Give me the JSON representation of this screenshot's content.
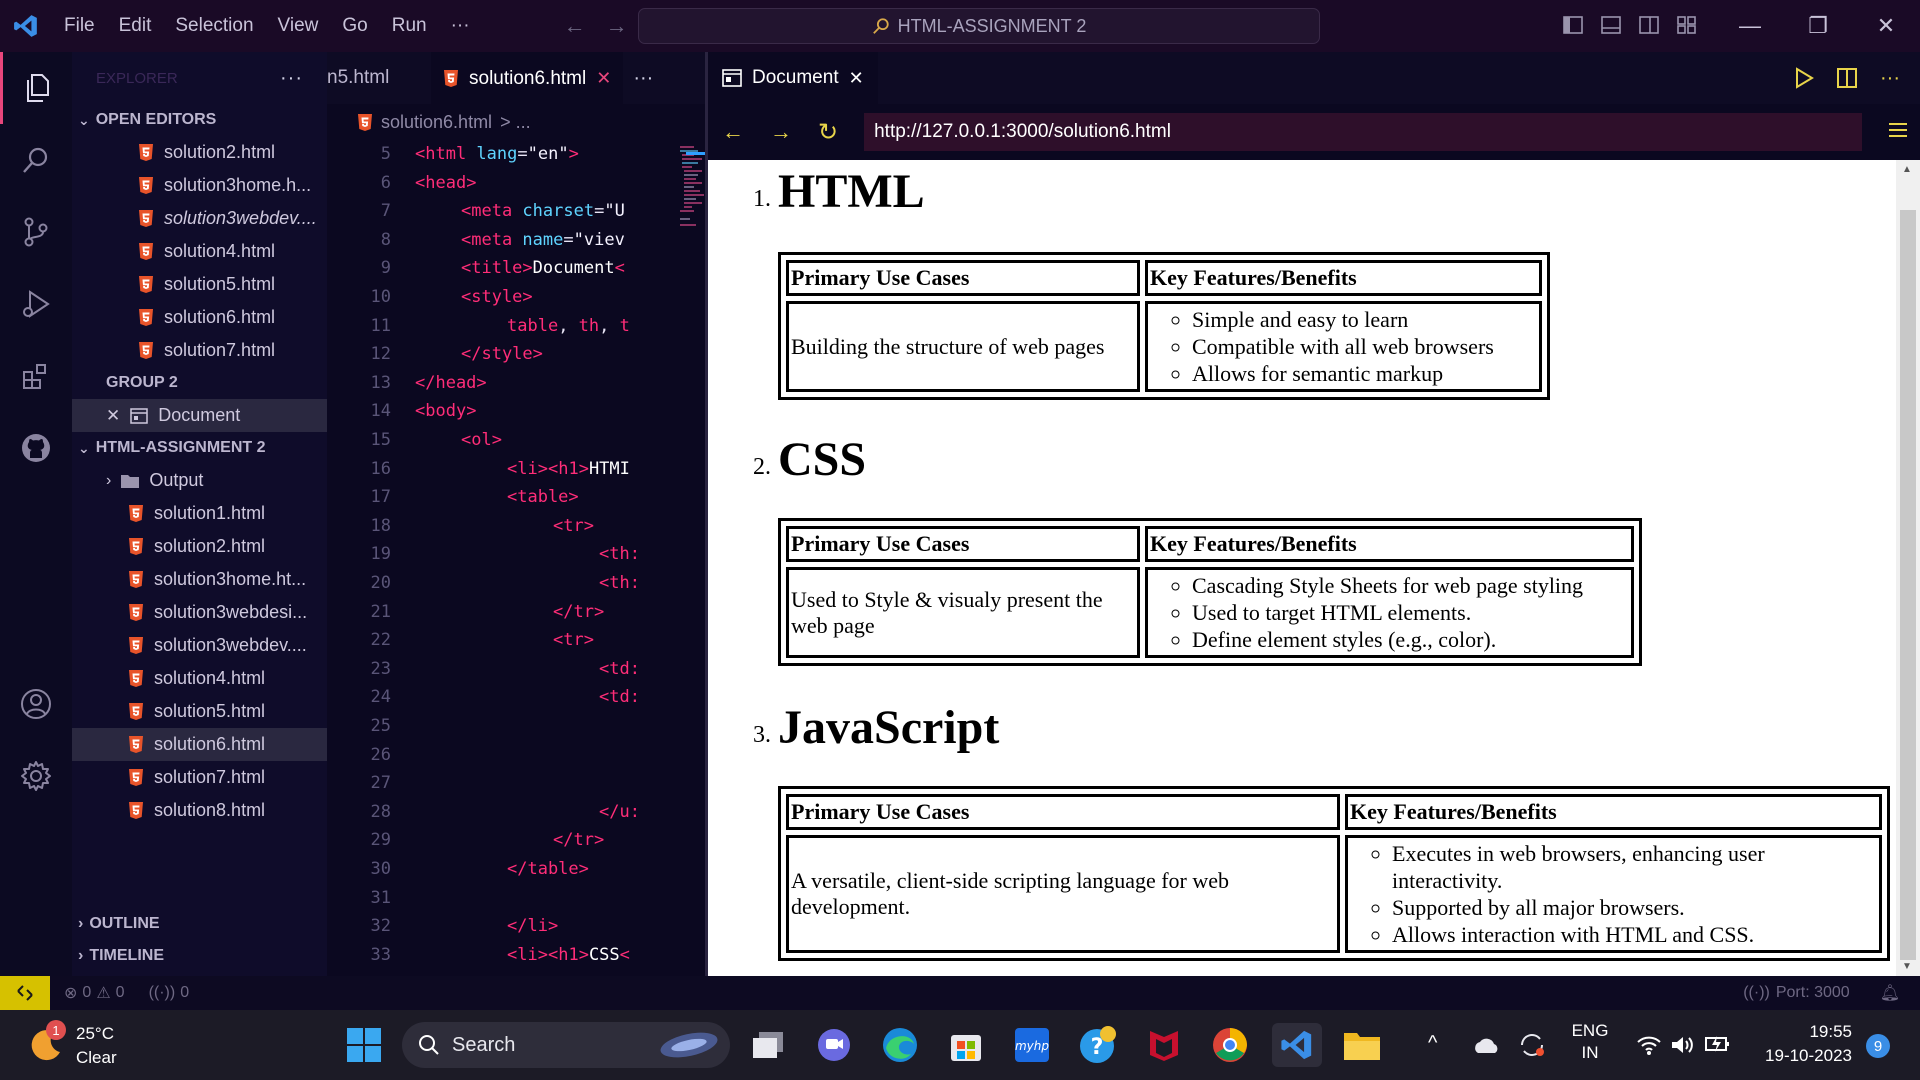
{
  "titlebar": {
    "menu": [
      "File",
      "Edit",
      "Selection",
      "View",
      "Go",
      "Run",
      "···"
    ],
    "search_text": "HTML-ASSIGNMENT 2"
  },
  "sidebar": {
    "header": "EXPLORER",
    "open_editors_title": "OPEN EDITORS",
    "open_editors": [
      {
        "label": "solution2.html",
        "italic": false
      },
      {
        "label": "solution3home.h...",
        "italic": false
      },
      {
        "label": "solution3webdev....",
        "italic": true
      },
      {
        "label": "solution4.html",
        "italic": false
      },
      {
        "label": "solution5.html",
        "italic": false
      },
      {
        "label": "solution6.html",
        "italic": false
      },
      {
        "label": "solution7.html",
        "italic": false
      }
    ],
    "group2_title": "GROUP 2",
    "group2_item": "Document",
    "project_title": "HTML-ASSIGNMENT 2",
    "folder": "Output",
    "files": [
      "solution1.html",
      "solution2.html",
      "solution3home.ht...",
      "solution3webdesi...",
      "solution3webdev....",
      "solution4.html",
      "solution5.html",
      "solution6.html",
      "solution7.html",
      "solution8.html"
    ],
    "selected_file": "solution6.html",
    "outline_title": "OUTLINE",
    "timeline_title": "TIMELINE"
  },
  "editor": {
    "tab_partial": "n5.html",
    "tab_active": "solution6.html",
    "breadcrumb_file": "solution6.html",
    "breadcrumb_rest": "> ...",
    "lines": [
      {
        "n": "5",
        "indent": 0,
        "parts": [
          [
            "tg",
            "<html"
          ],
          [
            "at",
            " lang"
          ],
          [
            "pn",
            "="
          ],
          [
            "st",
            "\"en\""
          ],
          [
            "tg",
            ">"
          ]
        ]
      },
      {
        "n": "6",
        "indent": 0,
        "parts": [
          [
            "tg",
            "<head"
          ],
          [
            "tg",
            ">"
          ]
        ]
      },
      {
        "n": "7",
        "indent": 1,
        "parts": [
          [
            "tg",
            "<meta"
          ],
          [
            "at",
            " charset"
          ],
          [
            "pn",
            "="
          ],
          [
            "st",
            "\"U"
          ]
        ]
      },
      {
        "n": "8",
        "indent": 1,
        "parts": [
          [
            "tg",
            "<meta"
          ],
          [
            "at",
            " name"
          ],
          [
            "pn",
            "="
          ],
          [
            "st",
            "\"viev"
          ]
        ]
      },
      {
        "n": "9",
        "indent": 1,
        "parts": [
          [
            "tg",
            "<title"
          ],
          [
            "tg",
            ">"
          ],
          [
            "tx",
            "Document"
          ],
          [
            "tg",
            "<"
          ]
        ]
      },
      {
        "n": "10",
        "indent": 1,
        "parts": [
          [
            "tg",
            "<style"
          ],
          [
            "tg",
            ">"
          ]
        ]
      },
      {
        "n": "11",
        "indent": 2,
        "parts": [
          [
            "tg",
            "table"
          ],
          [
            "pn",
            ", "
          ],
          [
            "tg",
            "th"
          ],
          [
            "pn",
            ", "
          ],
          [
            "tg",
            "t"
          ]
        ]
      },
      {
        "n": "12",
        "indent": 1,
        "parts": [
          [
            "tg",
            "</style"
          ],
          [
            "tg",
            ">"
          ]
        ]
      },
      {
        "n": "13",
        "indent": 0,
        "parts": [
          [
            "tg",
            "</head"
          ],
          [
            "tg",
            ">"
          ]
        ]
      },
      {
        "n": "14",
        "indent": 0,
        "parts": [
          [
            "tg",
            "<body"
          ],
          [
            "tg",
            ">"
          ]
        ]
      },
      {
        "n": "15",
        "indent": 1,
        "parts": [
          [
            "tg",
            "<ol"
          ],
          [
            "tg",
            ">"
          ]
        ]
      },
      {
        "n": "16",
        "indent": 2,
        "parts": [
          [
            "tg",
            "<li"
          ],
          [
            "tg",
            ">"
          ],
          [
            "tg",
            "<h1"
          ],
          [
            "tg",
            ">"
          ],
          [
            "tx",
            "HTMI"
          ]
        ]
      },
      {
        "n": "17",
        "indent": 2,
        "parts": [
          [
            "tg",
            "<table"
          ],
          [
            "tg",
            ">"
          ]
        ]
      },
      {
        "n": "18",
        "indent": 3,
        "parts": [
          [
            "tg",
            "<tr"
          ],
          [
            "tg",
            ">"
          ]
        ]
      },
      {
        "n": "19",
        "indent": 4,
        "parts": [
          [
            "tg",
            "<th:"
          ]
        ]
      },
      {
        "n": "20",
        "indent": 4,
        "parts": [
          [
            "tg",
            "<th:"
          ]
        ]
      },
      {
        "n": "21",
        "indent": 3,
        "parts": [
          [
            "tg",
            "</tr"
          ],
          [
            "tg",
            ">"
          ]
        ]
      },
      {
        "n": "22",
        "indent": 3,
        "parts": [
          [
            "tg",
            "<tr"
          ],
          [
            "tg",
            ">"
          ]
        ]
      },
      {
        "n": "23",
        "indent": 4,
        "parts": [
          [
            "tg",
            "<td:"
          ]
        ]
      },
      {
        "n": "24",
        "indent": 4,
        "parts": [
          [
            "tg",
            "<td:"
          ]
        ]
      },
      {
        "n": "25",
        "indent": 0,
        "parts": []
      },
      {
        "n": "26",
        "indent": 0,
        "parts": []
      },
      {
        "n": "27",
        "indent": 0,
        "parts": []
      },
      {
        "n": "28",
        "indent": 4,
        "parts": [
          [
            "tg",
            "</u:"
          ]
        ]
      },
      {
        "n": "29",
        "indent": 3,
        "parts": [
          [
            "tg",
            "</tr"
          ],
          [
            "tg",
            ">"
          ]
        ]
      },
      {
        "n": "30",
        "indent": 2,
        "parts": [
          [
            "tg",
            "</table"
          ],
          [
            "tg",
            ">"
          ]
        ]
      },
      {
        "n": "31",
        "indent": 0,
        "parts": []
      },
      {
        "n": "32",
        "indent": 2,
        "parts": [
          [
            "tg",
            "</li"
          ],
          [
            "tg",
            ">"
          ]
        ]
      },
      {
        "n": "33",
        "indent": 2,
        "parts": [
          [
            "tg",
            "<li"
          ],
          [
            "tg",
            ">"
          ],
          [
            "tg",
            "<h1"
          ],
          [
            "tg",
            ">"
          ],
          [
            "tx",
            "CSS"
          ],
          [
            "tg",
            "<"
          ]
        ]
      }
    ]
  },
  "browser": {
    "tab_label": "Document",
    "url": "http://127.0.0.1:3000/solution6.html",
    "sections": [
      {
        "num": "1.",
        "title": "HTML",
        "th1": "Primary Use Cases",
        "th2": "Key Features/Benefits",
        "use": "Building the structure of web pages",
        "features": [
          "Simple and easy to learn",
          "Compatible with all web browsers",
          "Allows for semantic markup"
        ]
      },
      {
        "num": "2.",
        "title": "CSS",
        "th1": "Primary Use Cases",
        "th2": "Key Features/Benefits",
        "use": "Used to Style & visualy present the web page",
        "features": [
          "Cascading Style Sheets for web page styling",
          "Used to target HTML elements.",
          "Define element styles (e.g., color)."
        ]
      },
      {
        "num": "3.",
        "title": "JavaScript",
        "th1": "Primary Use Cases",
        "th2": "Key Features/Benefits",
        "use": "A versatile, client-side scripting language for web development.",
        "features": [
          "Executes in web browsers, enhancing user interactivity.",
          "Supported by all major browsers.",
          "Allows interaction with HTML and CSS."
        ]
      }
    ]
  },
  "statusbar": {
    "errors": "0",
    "warnings": "0",
    "ports_count": "0",
    "port": "Port: 3000"
  },
  "taskbar": {
    "weather_badge": "1",
    "temp": "25°C",
    "condition": "Clear",
    "search": "Search",
    "lang1": "ENG",
    "lang2": "IN",
    "time": "19:55",
    "date": "19-10-2023",
    "notif": "9"
  },
  "colors": {
    "accent_tag": "#ff2d78",
    "attr": "#5fd4ff",
    "remote": "#d6c100"
  }
}
